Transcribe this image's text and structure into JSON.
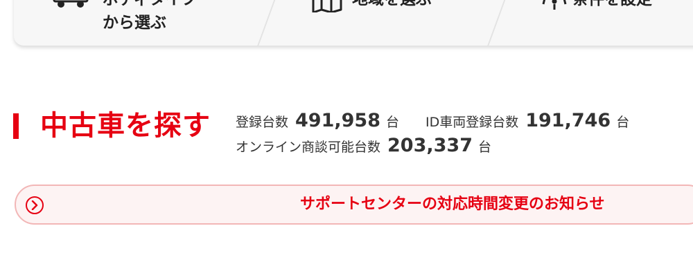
{
  "search_methods": [
    {
      "label_line1": "ボディタイプ",
      "label_line2": "から選ぶ",
      "icon": "truck-icon"
    },
    {
      "label_line1": "地域を選ぶ",
      "icon": "map-icon"
    },
    {
      "label_line1": "条件を設定",
      "icon": "filter-icon"
    }
  ],
  "heading": {
    "title": "中古車を探す",
    "accent_color": "#e60012"
  },
  "stats": {
    "registered_label": "登録台数",
    "registered_count": "491,958",
    "registered_unit": "台",
    "id_label": "ID車両登録台数",
    "id_count": "191,746",
    "id_unit": "台",
    "online_label": "オンライン商談可能台数",
    "online_count": "203,337",
    "online_unit": "台"
  },
  "notice": {
    "text": "サポートセンターの対応時間変更のお知らせ",
    "icon": "chevron-right-circle-icon"
  }
}
